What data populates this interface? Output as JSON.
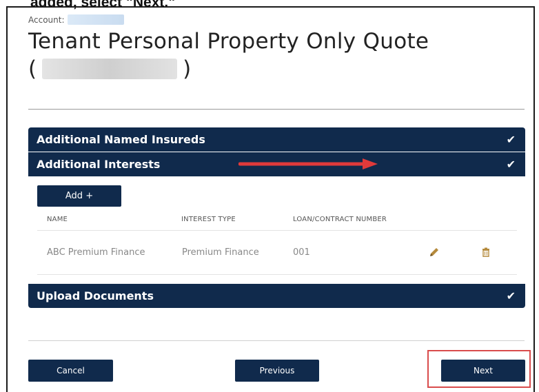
{
  "caption": "added, select \"Next.\"",
  "account_label": "Account:",
  "title_line1": "Tenant Personal Property Only Quote",
  "title_open_paren": "(",
  "title_close_paren": ")",
  "sections": {
    "named_insureds": "Additional Named Insureds",
    "interests": "Additional Interests",
    "upload": "Upload Documents"
  },
  "check_glyph": "✔",
  "add_button": "Add +",
  "table": {
    "headers": [
      "NAME",
      "INTEREST TYPE",
      "LOAN/CONTRACT NUMBER"
    ],
    "rows": [
      {
        "name": "ABC Premium Finance",
        "type": "Premium Finance",
        "number": "001"
      }
    ]
  },
  "buttons": {
    "cancel": "Cancel",
    "previous": "Previous",
    "next": "Next"
  },
  "colors": {
    "navy": "#102a4c",
    "arrow_red": "#e03a3a",
    "icon_gold": "#b58a3c"
  }
}
